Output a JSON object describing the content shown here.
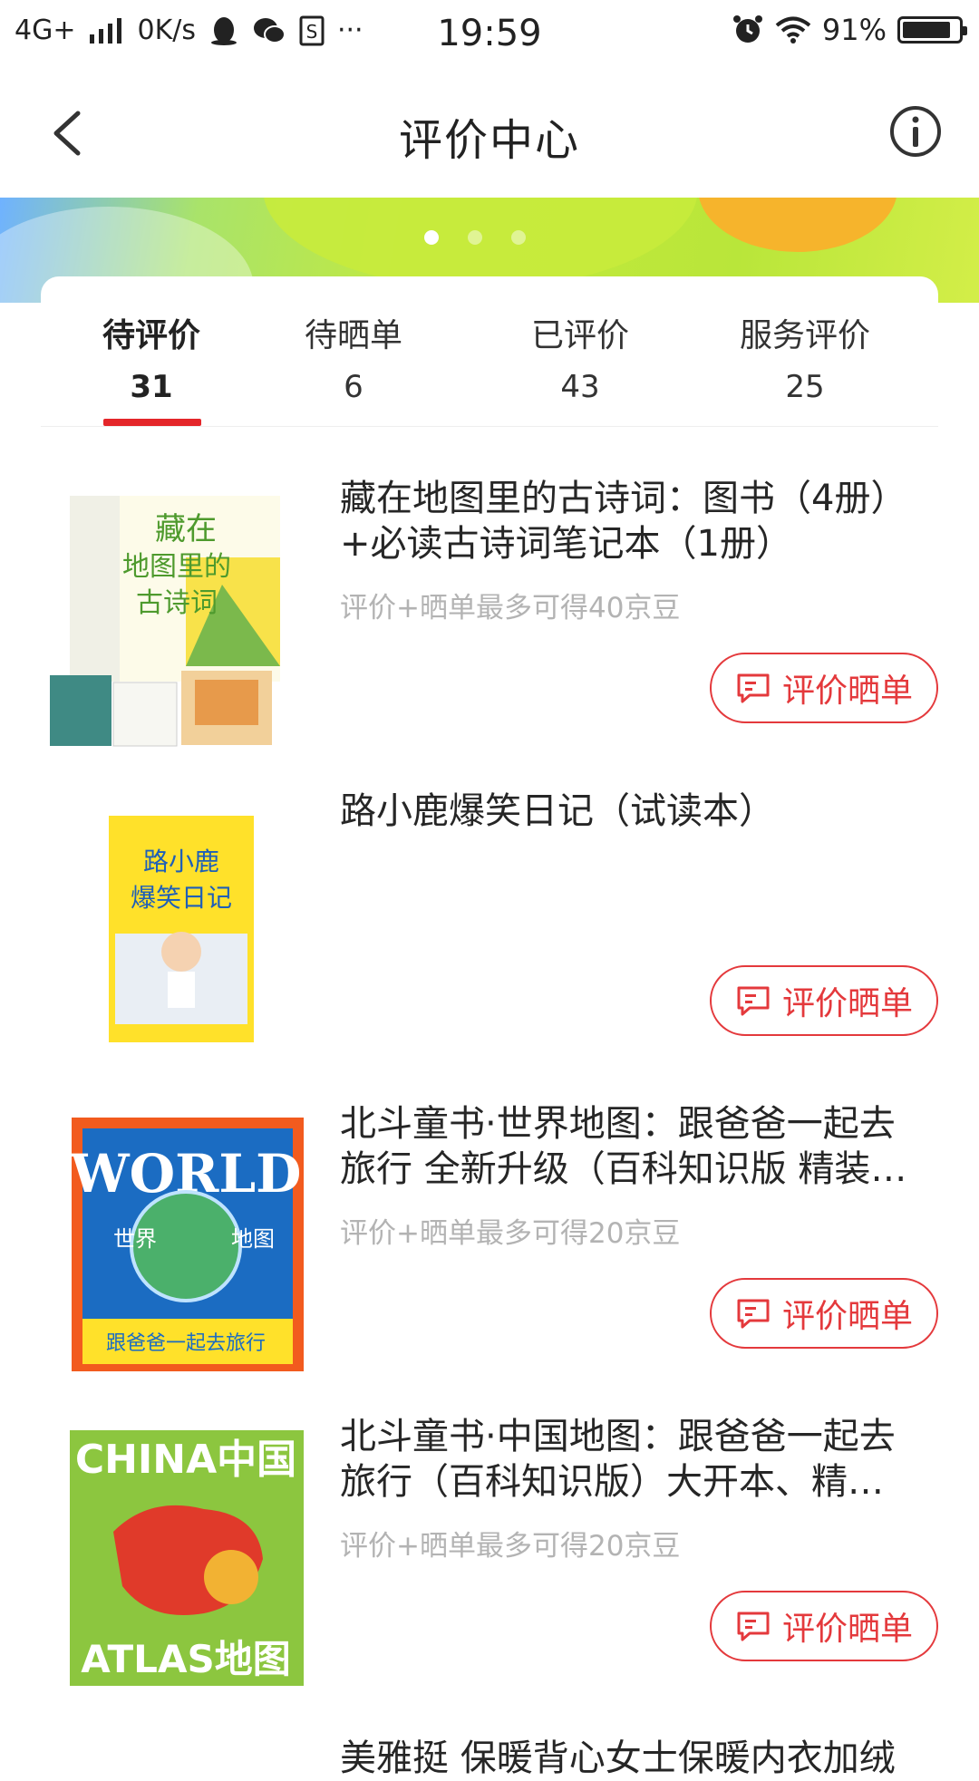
{
  "status_bar": {
    "network": "4G+",
    "speed": "0K/s",
    "more": "···",
    "time": "19:59",
    "battery_percent": "91%",
    "battery_level": 0.91
  },
  "nav": {
    "title": "评价中心"
  },
  "banner": {
    "slide_count": 3,
    "active_slide": 0
  },
  "tabs": [
    {
      "label": "待评价",
      "count": "31",
      "active": true
    },
    {
      "label": "待晒单",
      "count": "6",
      "active": false
    },
    {
      "label": "已评价",
      "count": "43",
      "active": false
    },
    {
      "label": "服务评价",
      "count": "25",
      "active": false
    }
  ],
  "items": [
    {
      "title": "藏在地图里的古诗词：图书（4册）+必读古诗词笔记本（1册）",
      "subtitle": "评价+晒单最多可得40京豆",
      "button": "评价晒单",
      "image": "book-cover-ancient-poems"
    },
    {
      "title": "路小鹿爆笑日记（试读本）",
      "subtitle": "",
      "button": "评价晒单",
      "image": "book-cover-lu-xiaolu-diary"
    },
    {
      "title": "北斗童书·世界地图：跟爸爸一起去旅行 全新升级（百科知识版 精装…",
      "subtitle": "评价+晒单最多可得20京豆",
      "button": "评价晒单",
      "image": "book-cover-world-atlas"
    },
    {
      "title": "北斗童书·中国地图：跟爸爸一起去旅行（百科知识版）大开本、精…",
      "subtitle": "评价+晒单最多可得20京豆",
      "button": "评价晒单",
      "image": "book-cover-china-atlas"
    }
  ],
  "peek_item": {
    "title": "美雅挺 保暖背心女士保暖内衣加绒"
  },
  "colors": {
    "accent": "#e4393c",
    "tab_indicator": "#e4262a",
    "subtitle": "#b3b3b3"
  }
}
